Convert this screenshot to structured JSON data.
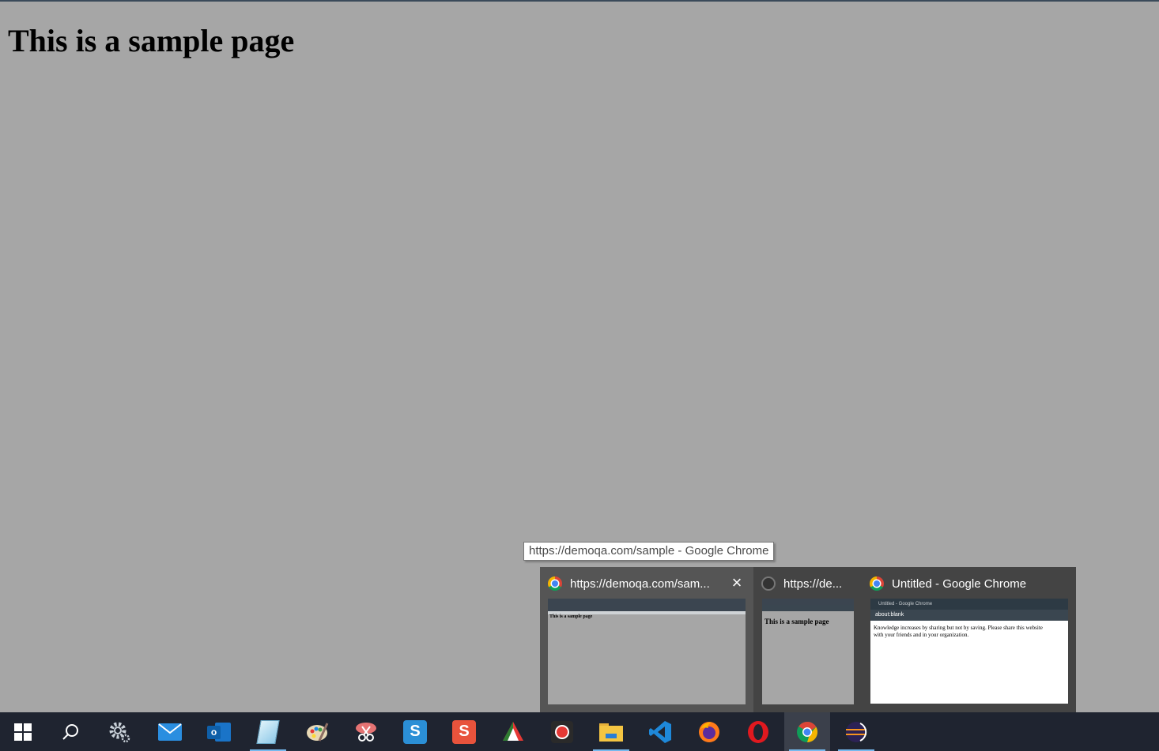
{
  "page": {
    "heading": "This is a sample page"
  },
  "tooltip": {
    "text": "https://demoqa.com/sample - Google Chrome"
  },
  "preview_popup": {
    "items": [
      {
        "title": "https://demoqa.com/sam...",
        "thumbnail_text": "This is a sample page",
        "close_symbol": "×"
      },
      {
        "title": "https://de...",
        "thumbnail_text": "This is a sample page"
      },
      {
        "title": "Untitled - Google Chrome",
        "thumbnail_window_title": "Untitled - Google Chrome",
        "thumbnail_address": "about:blank",
        "thumbnail_text": "Knowledge increases by sharing but not by saving. Please share this website with your friends and in your organization."
      }
    ]
  },
  "taskbar": {
    "accent_color": "#76b9ed",
    "items": [
      {
        "icon": "windows-start-icon"
      },
      {
        "icon": "search-icon"
      },
      {
        "icon": "settings-gear-icon"
      },
      {
        "icon": "mail-icon"
      },
      {
        "icon": "outlook-icon"
      },
      {
        "icon": "notepad-icon"
      },
      {
        "icon": "paint-icon"
      },
      {
        "icon": "snipping-tool-icon"
      },
      {
        "icon": "snagit-icon"
      },
      {
        "icon": "snagit-editor-icon"
      },
      {
        "icon": "mixed-colors-icon"
      },
      {
        "icon": "screen-recorder-icon"
      },
      {
        "icon": "file-explorer-icon"
      },
      {
        "icon": "vscode-icon"
      },
      {
        "icon": "firefox-icon"
      },
      {
        "icon": "opera-icon"
      },
      {
        "icon": "chrome-icon"
      },
      {
        "icon": "eclipse-icon"
      }
    ]
  }
}
